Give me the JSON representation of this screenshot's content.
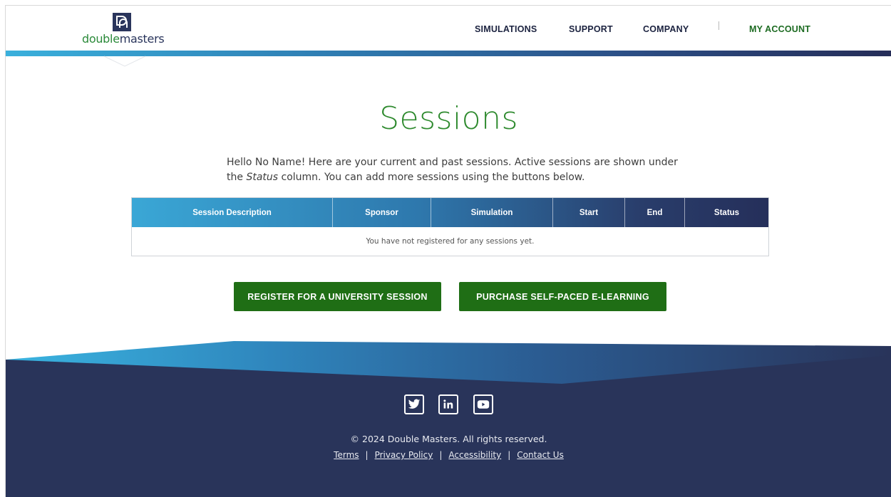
{
  "brand": {
    "logo_text_a": "double",
    "logo_text_b": "masters"
  },
  "nav": {
    "simulations": "SIMULATIONS",
    "support": "SUPPORT",
    "company": "COMPANY",
    "account": "MY ACCOUNT"
  },
  "main": {
    "title": "Sessions",
    "intro_1": "Hello No Name! Here are your current and past sessions. Active sessions are shown under the",
    "intro_status": "Status",
    "intro_2": " column. You can add more sessions using the buttons below."
  },
  "table": {
    "columns": [
      "Session Description",
      "Sponsor",
      "Simulation",
      "Start",
      "End",
      "Status"
    ],
    "empty_message": "You have not registered for any sessions yet."
  },
  "buttons": {
    "register": "REGISTER FOR A UNIVERSITY SESSION",
    "purchase": "PURCHASE SELF-PACED E-LEARNING"
  },
  "footer": {
    "copyright": "© 2024 Double Masters. All rights reserved.",
    "links": [
      "Terms",
      "Privacy Policy",
      "Accessibility",
      "Contact Us"
    ],
    "social": [
      "twitter-icon",
      "linkedin-icon",
      "youtube-icon"
    ]
  },
  "colors": {
    "accent_green": "#1f6e15",
    "title_green": "#2e8a2e",
    "navy": "#29345a",
    "blue": "#3aa7d6"
  }
}
